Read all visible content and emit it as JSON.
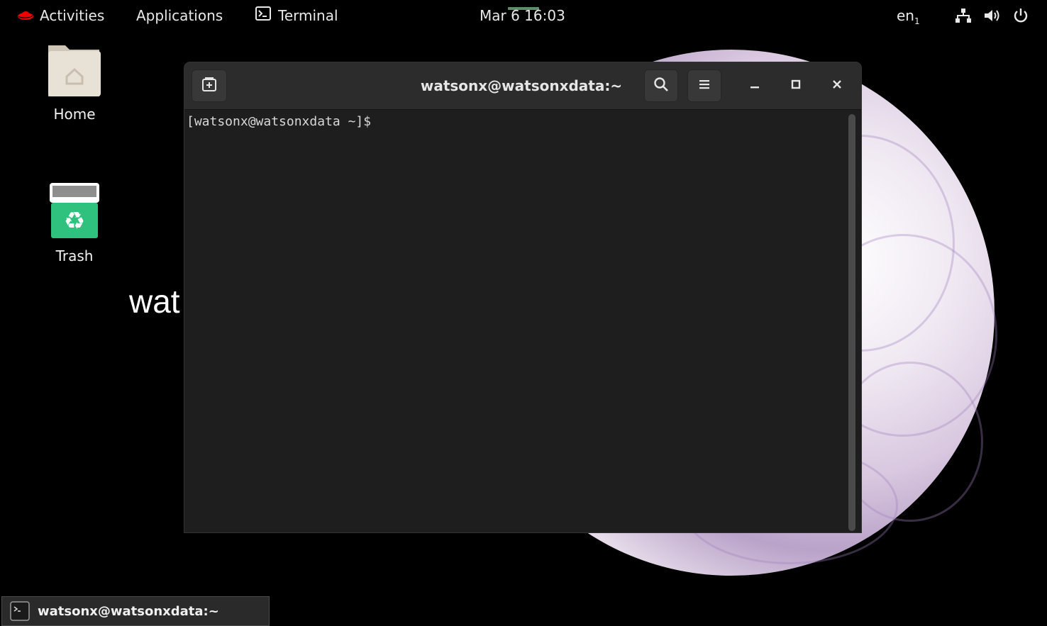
{
  "topbar": {
    "activities": "Activities",
    "applications": "Applications",
    "terminal": "Terminal",
    "clock": "Mar 6  16:03",
    "lang": "en",
    "lang_sub": "1",
    "icons": [
      "redhat-icon",
      "terminal-icon",
      "network-icon",
      "volume-icon",
      "power-icon"
    ]
  },
  "desktop": {
    "home_label": "Home",
    "trash_label": "Trash",
    "wallpaper_text": "wat"
  },
  "terminal_window": {
    "title": "watsonx@watsonxdata:~",
    "prompt": "[watsonx@watsonxdata ~]$",
    "buttons": [
      "new-tab-icon",
      "search-icon",
      "hamburger-menu-icon",
      "minimize-icon",
      "maximize-icon",
      "close-icon"
    ]
  },
  "taskbar": {
    "entry_label": "watsonx@watsonxdata:~"
  },
  "colors": {
    "accent_red": "#ee0000",
    "trash_green": "#2ec27e",
    "folder_beige": "#e8e1d6"
  }
}
